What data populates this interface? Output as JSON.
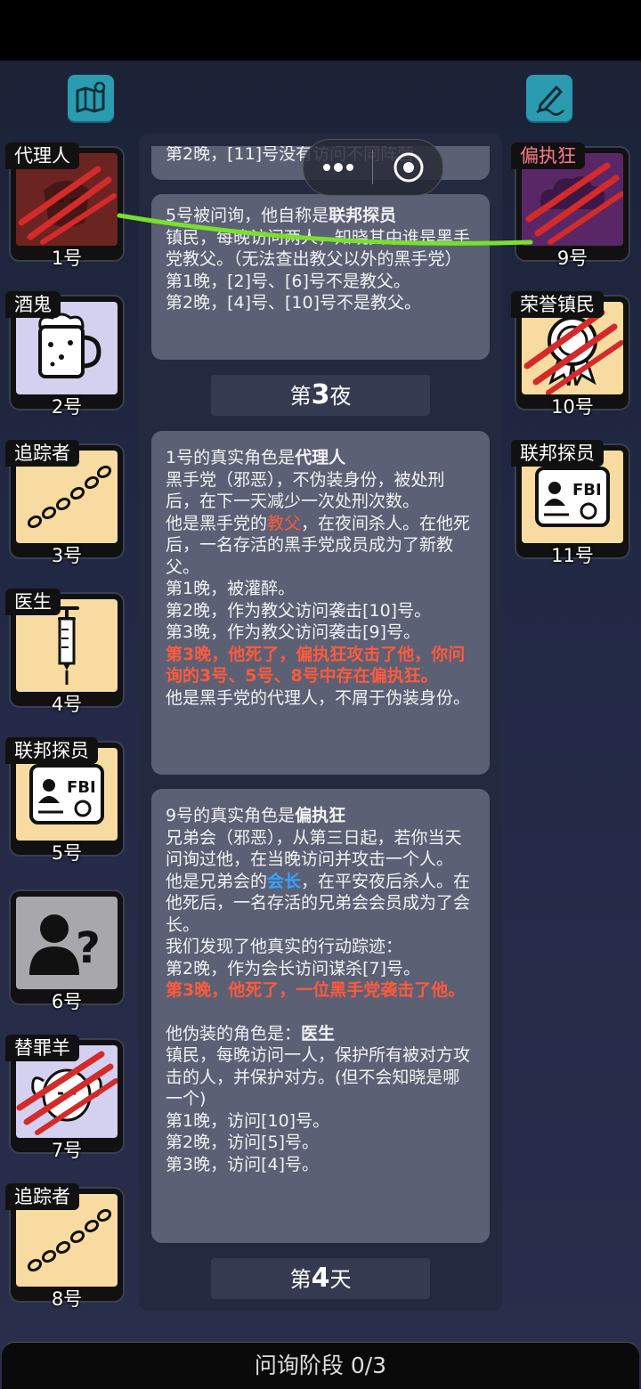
{
  "header": {
    "map_icon": "map-icon",
    "notes_icon": "notes-icon"
  },
  "left_cards": [
    {
      "role": "代理人",
      "number": "1号",
      "icon": "mask-icon"
    },
    {
      "role": "酒鬼",
      "number": "2号",
      "icon": "beer-mug-icon"
    },
    {
      "role": "追踪者",
      "number": "3号",
      "icon": "footprints-icon"
    },
    {
      "role": "医生",
      "number": "4号",
      "icon": "syringe-icon"
    },
    {
      "role": "联邦探员",
      "number": "5号",
      "icon": "fbi-badge-icon"
    },
    {
      "role": "",
      "number": "6号",
      "icon": "unknown-person-icon"
    },
    {
      "role": "替罪羊",
      "number": "7号",
      "icon": "scapegoat-icon"
    },
    {
      "role": "追踪者",
      "number": "8号",
      "icon": "footprints-icon"
    }
  ],
  "right_cards": [
    {
      "role": "偏执狂",
      "number": "9号",
      "icon": "cloud-gun-icon"
    },
    {
      "role": "荣誉镇民",
      "number": "10号",
      "icon": "medal-icon"
    },
    {
      "role": "联邦探员",
      "number": "11号",
      "icon": "fbi-badge-icon"
    }
  ],
  "log": {
    "msg0_line": "第2晚，[11]号没有访问不同阵营。",
    "msg1": {
      "l1_pre": "5号被问询，他自称是",
      "l1_role": "联邦探员",
      "l2": "镇民，每晚访问两人，知晓其中谁是黑手党教父。（无法查出教父以外的黑手党）",
      "l3": "第1晚，[2]号、[6]号不是教父。",
      "l4": "第2晚，[4]号、[10]号不是教父。"
    },
    "night3_pre": "第",
    "night3_num": "3",
    "night3_post": "夜",
    "msg2": {
      "l1_pre": "1号的真实角色是",
      "l1_role": "代理人",
      "l2": "黑手党（邪恶），不伪装身份，被处刑后，在下一天减少一次处刑次数。",
      "l3_pre": "他是黑手党的",
      "l3_role": "教父",
      "l3_post": "，在夜间杀人。在他死后，一名存活的黑手党成员成为了新教父。",
      "l4": "第1晚，被灌醉。",
      "l5": "第2晚，作为教父访问袭击[10]号。",
      "l6": "第3晚，作为教父访问袭击[9]号。",
      "l7": "第3晚，他死了，偏执狂攻击了他，你问询的3号、5号、8号中存在偏执狂。",
      "l8": "他是黑手党的代理人，不屑于伪装身份。"
    },
    "msg3": {
      "l1_pre": "9号的真实角色是",
      "l1_role": "偏执狂",
      "l2": "兄弟会（邪恶），从第三日起，若你当天问询过他，在当晚访问并攻击一个人。",
      "l3_pre": "他是兄弟会的",
      "l3_role": "会长",
      "l3_post": "，在平安夜后杀人。在他死后，一名存活的兄弟会会员成为了会长。",
      "l4": "我们发现了他真实的行动踪迹：",
      "l5": "第2晚，作为会长访问谋杀[7]号。",
      "l6": "第3晚，他死了，一位黑手党袭击了他。",
      "l7_pre": "他伪装的角色是：",
      "l7_role": "医生",
      "l8": "镇民，每晚访问一人，保护所有被对方攻击的人，并保护对方。(但不会知晓是哪一个)",
      "l9": "第1晚，访问[10]号。",
      "l10": "第2晚，访问[5]号。",
      "l11": "第3晚，访问[4]号。"
    },
    "day4_pre": "第",
    "day4_num": "4",
    "day4_post": "天"
  },
  "bottom": {
    "phase_label": "问询阶段 0/3"
  },
  "colors": {
    "accent_teal": "#2a9bb0",
    "danger_red": "#ff5a3c",
    "highlight_blue": "#36a3ff",
    "card_cream": "#f8dba0"
  }
}
